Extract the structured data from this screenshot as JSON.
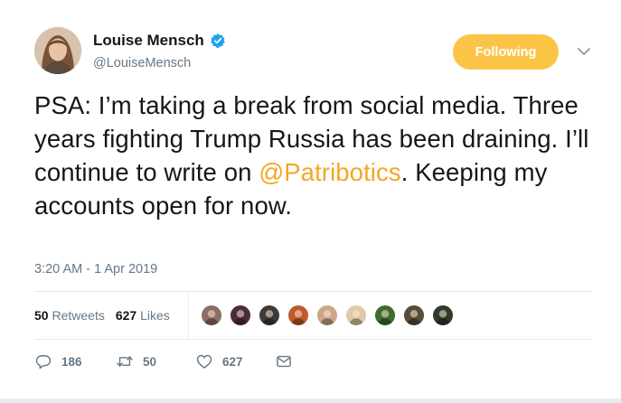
{
  "author": {
    "display_name": "Louise Mensch",
    "handle": "@LouiseMensch",
    "verified": true
  },
  "follow_button": {
    "label": "Following"
  },
  "tweet": {
    "text_before": "PSA: I’m taking a break from social media. Three years fighting Trump Russia has been draining. I’ll continue to write on ",
    "mention": "@Patribotics",
    "text_after": ". Keeping my accounts open for now.",
    "timestamp": "3:20 AM - 1 Apr 2019"
  },
  "stats": {
    "retweets_count": "50",
    "retweets_label": "Retweets",
    "likes_count": "627",
    "likes_label": "Likes"
  },
  "likers": [
    {
      "icon": "avatar-1",
      "color": "#8d6e63"
    },
    {
      "icon": "avatar-2",
      "color": "#4a2c3a"
    },
    {
      "icon": "avatar-3",
      "color": "#3b3b3b"
    },
    {
      "icon": "avatar-4",
      "color": "#c05a2a"
    },
    {
      "icon": "avatar-5",
      "color": "#c9a68a"
    },
    {
      "icon": "avatar-6",
      "color": "#e0c9a6"
    },
    {
      "icon": "avatar-7",
      "color": "#3f6b2f"
    },
    {
      "icon": "avatar-8",
      "color": "#5a4a3a"
    },
    {
      "icon": "avatar-9",
      "color": "#2f3a2a"
    }
  ],
  "actions": {
    "reply_count": "186",
    "retweet_count": "50",
    "like_count": "627"
  },
  "colors": {
    "accent": "#fcc447",
    "mention": "#f5a623",
    "verified": "#1da1f2",
    "secondary_text": "#657786"
  }
}
